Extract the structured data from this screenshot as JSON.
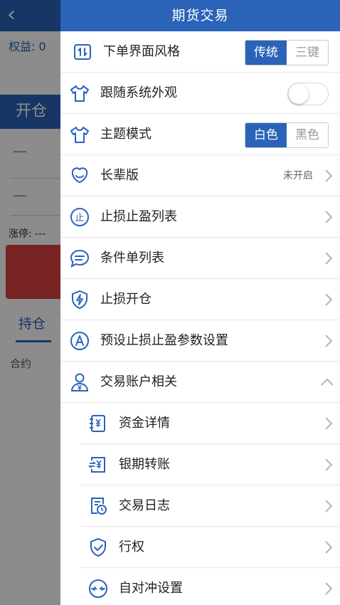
{
  "background": {
    "back_glyph": "‹",
    "equity_label": "权益: 0",
    "open_label": "开仓",
    "limit_label": "涨停: ---",
    "dash": "—",
    "position_tab": "持仓",
    "contract_label": "合约"
  },
  "panel": {
    "title": "期货交易",
    "items": [
      {
        "label": "下单界面风格",
        "icon": "order-style-icon",
        "control": "segment",
        "options": [
          "传统",
          "三键"
        ],
        "selected": 0
      },
      {
        "label": "跟随系统外观",
        "icon": "shirt-icon",
        "control": "toggle",
        "value": false
      },
      {
        "label": "主题模式",
        "icon": "shirt-icon",
        "control": "segment",
        "options": [
          "白色",
          "黑色"
        ],
        "selected": 0
      },
      {
        "label": "长辈版",
        "icon": "smile-icon",
        "control": "chevron",
        "status": "未开启"
      },
      {
        "label": "止损止盈列表",
        "icon": "stop-icon",
        "control": "chevron"
      },
      {
        "label": "条件单列表",
        "icon": "chat-list-icon",
        "control": "chevron"
      },
      {
        "label": "止损开仓",
        "icon": "bolt-shield-icon",
        "control": "chevron"
      },
      {
        "label": "预设止损止盈参数设置",
        "icon": "circle-a-icon",
        "control": "chevron"
      },
      {
        "label": "交易账户相关",
        "icon": "account-user-icon",
        "control": "chevron-up"
      }
    ],
    "subitems": [
      {
        "label": "资金详情",
        "icon": "yuan-doc-icon"
      },
      {
        "label": "银期转账",
        "icon": "yuan-transfer-icon"
      },
      {
        "label": "交易日志",
        "icon": "log-clock-icon"
      },
      {
        "label": "行权",
        "icon": "shield-check-icon"
      },
      {
        "label": "自对冲设置",
        "icon": "hedge-arrows-icon"
      }
    ]
  },
  "colors": {
    "accent": "#2a63b8",
    "background_dim": "rgba(0,0,0,0.45)",
    "sell_red": "#d94040"
  }
}
